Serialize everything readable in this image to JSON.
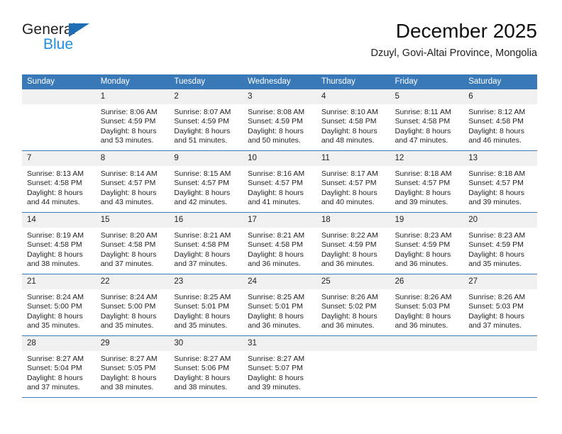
{
  "brand": {
    "name_part1": "General",
    "name_part2": "Blue",
    "triangle_icon": "triangle-icon",
    "accent_blue": "#1f8fe0",
    "dark_blue": "#1f6eb5"
  },
  "header": {
    "title": "December 2025",
    "subtitle": "Dzuyl, Govi-Altai Province, Mongolia"
  },
  "theme": {
    "header_bg": "#3a79b8",
    "daynum_bg": "#f0f0f0",
    "text": "#222222"
  },
  "weekdays": [
    "Sunday",
    "Monday",
    "Tuesday",
    "Wednesday",
    "Thursday",
    "Friday",
    "Saturday"
  ],
  "weeks": [
    [
      {
        "day": "",
        "empty": true,
        "sunrise": "",
        "sunset": "",
        "daylight1": "",
        "daylight2": ""
      },
      {
        "day": "1",
        "sunrise": "Sunrise: 8:06 AM",
        "sunset": "Sunset: 4:59 PM",
        "daylight1": "Daylight: 8 hours",
        "daylight2": "and 53 minutes."
      },
      {
        "day": "2",
        "sunrise": "Sunrise: 8:07 AM",
        "sunset": "Sunset: 4:59 PM",
        "daylight1": "Daylight: 8 hours",
        "daylight2": "and 51 minutes."
      },
      {
        "day": "3",
        "sunrise": "Sunrise: 8:08 AM",
        "sunset": "Sunset: 4:59 PM",
        "daylight1": "Daylight: 8 hours",
        "daylight2": "and 50 minutes."
      },
      {
        "day": "4",
        "sunrise": "Sunrise: 8:10 AM",
        "sunset": "Sunset: 4:58 PM",
        "daylight1": "Daylight: 8 hours",
        "daylight2": "and 48 minutes."
      },
      {
        "day": "5",
        "sunrise": "Sunrise: 8:11 AM",
        "sunset": "Sunset: 4:58 PM",
        "daylight1": "Daylight: 8 hours",
        "daylight2": "and 47 minutes."
      },
      {
        "day": "6",
        "sunrise": "Sunrise: 8:12 AM",
        "sunset": "Sunset: 4:58 PM",
        "daylight1": "Daylight: 8 hours",
        "daylight2": "and 46 minutes."
      }
    ],
    [
      {
        "day": "7",
        "sunrise": "Sunrise: 8:13 AM",
        "sunset": "Sunset: 4:58 PM",
        "daylight1": "Daylight: 8 hours",
        "daylight2": "and 44 minutes."
      },
      {
        "day": "8",
        "sunrise": "Sunrise: 8:14 AM",
        "sunset": "Sunset: 4:57 PM",
        "daylight1": "Daylight: 8 hours",
        "daylight2": "and 43 minutes."
      },
      {
        "day": "9",
        "sunrise": "Sunrise: 8:15 AM",
        "sunset": "Sunset: 4:57 PM",
        "daylight1": "Daylight: 8 hours",
        "daylight2": "and 42 minutes."
      },
      {
        "day": "10",
        "sunrise": "Sunrise: 8:16 AM",
        "sunset": "Sunset: 4:57 PM",
        "daylight1": "Daylight: 8 hours",
        "daylight2": "and 41 minutes."
      },
      {
        "day": "11",
        "sunrise": "Sunrise: 8:17 AM",
        "sunset": "Sunset: 4:57 PM",
        "daylight1": "Daylight: 8 hours",
        "daylight2": "and 40 minutes."
      },
      {
        "day": "12",
        "sunrise": "Sunrise: 8:18 AM",
        "sunset": "Sunset: 4:57 PM",
        "daylight1": "Daylight: 8 hours",
        "daylight2": "and 39 minutes."
      },
      {
        "day": "13",
        "sunrise": "Sunrise: 8:18 AM",
        "sunset": "Sunset: 4:57 PM",
        "daylight1": "Daylight: 8 hours",
        "daylight2": "and 39 minutes."
      }
    ],
    [
      {
        "day": "14",
        "sunrise": "Sunrise: 8:19 AM",
        "sunset": "Sunset: 4:58 PM",
        "daylight1": "Daylight: 8 hours",
        "daylight2": "and 38 minutes."
      },
      {
        "day": "15",
        "sunrise": "Sunrise: 8:20 AM",
        "sunset": "Sunset: 4:58 PM",
        "daylight1": "Daylight: 8 hours",
        "daylight2": "and 37 minutes."
      },
      {
        "day": "16",
        "sunrise": "Sunrise: 8:21 AM",
        "sunset": "Sunset: 4:58 PM",
        "daylight1": "Daylight: 8 hours",
        "daylight2": "and 37 minutes."
      },
      {
        "day": "17",
        "sunrise": "Sunrise: 8:21 AM",
        "sunset": "Sunset: 4:58 PM",
        "daylight1": "Daylight: 8 hours",
        "daylight2": "and 36 minutes."
      },
      {
        "day": "18",
        "sunrise": "Sunrise: 8:22 AM",
        "sunset": "Sunset: 4:59 PM",
        "daylight1": "Daylight: 8 hours",
        "daylight2": "and 36 minutes."
      },
      {
        "day": "19",
        "sunrise": "Sunrise: 8:23 AM",
        "sunset": "Sunset: 4:59 PM",
        "daylight1": "Daylight: 8 hours",
        "daylight2": "and 36 minutes."
      },
      {
        "day": "20",
        "sunrise": "Sunrise: 8:23 AM",
        "sunset": "Sunset: 4:59 PM",
        "daylight1": "Daylight: 8 hours",
        "daylight2": "and 35 minutes."
      }
    ],
    [
      {
        "day": "21",
        "sunrise": "Sunrise: 8:24 AM",
        "sunset": "Sunset: 5:00 PM",
        "daylight1": "Daylight: 8 hours",
        "daylight2": "and 35 minutes."
      },
      {
        "day": "22",
        "sunrise": "Sunrise: 8:24 AM",
        "sunset": "Sunset: 5:00 PM",
        "daylight1": "Daylight: 8 hours",
        "daylight2": "and 35 minutes."
      },
      {
        "day": "23",
        "sunrise": "Sunrise: 8:25 AM",
        "sunset": "Sunset: 5:01 PM",
        "daylight1": "Daylight: 8 hours",
        "daylight2": "and 35 minutes."
      },
      {
        "day": "24",
        "sunrise": "Sunrise: 8:25 AM",
        "sunset": "Sunset: 5:01 PM",
        "daylight1": "Daylight: 8 hours",
        "daylight2": "and 36 minutes."
      },
      {
        "day": "25",
        "sunrise": "Sunrise: 8:26 AM",
        "sunset": "Sunset: 5:02 PM",
        "daylight1": "Daylight: 8 hours",
        "daylight2": "and 36 minutes."
      },
      {
        "day": "26",
        "sunrise": "Sunrise: 8:26 AM",
        "sunset": "Sunset: 5:03 PM",
        "daylight1": "Daylight: 8 hours",
        "daylight2": "and 36 minutes."
      },
      {
        "day": "27",
        "sunrise": "Sunrise: 8:26 AM",
        "sunset": "Sunset: 5:03 PM",
        "daylight1": "Daylight: 8 hours",
        "daylight2": "and 37 minutes."
      }
    ],
    [
      {
        "day": "28",
        "sunrise": "Sunrise: 8:27 AM",
        "sunset": "Sunset: 5:04 PM",
        "daylight1": "Daylight: 8 hours",
        "daylight2": "and 37 minutes."
      },
      {
        "day": "29",
        "sunrise": "Sunrise: 8:27 AM",
        "sunset": "Sunset: 5:05 PM",
        "daylight1": "Daylight: 8 hours",
        "daylight2": "and 38 minutes."
      },
      {
        "day": "30",
        "sunrise": "Sunrise: 8:27 AM",
        "sunset": "Sunset: 5:06 PM",
        "daylight1": "Daylight: 8 hours",
        "daylight2": "and 38 minutes."
      },
      {
        "day": "31",
        "sunrise": "Sunrise: 8:27 AM",
        "sunset": "Sunset: 5:07 PM",
        "daylight1": "Daylight: 8 hours",
        "daylight2": "and 39 minutes."
      },
      {
        "day": "",
        "empty": true,
        "sunrise": "",
        "sunset": "",
        "daylight1": "",
        "daylight2": ""
      },
      {
        "day": "",
        "empty": true,
        "sunrise": "",
        "sunset": "",
        "daylight1": "",
        "daylight2": ""
      },
      {
        "day": "",
        "empty": true,
        "sunrise": "",
        "sunset": "",
        "daylight1": "",
        "daylight2": ""
      }
    ]
  ]
}
